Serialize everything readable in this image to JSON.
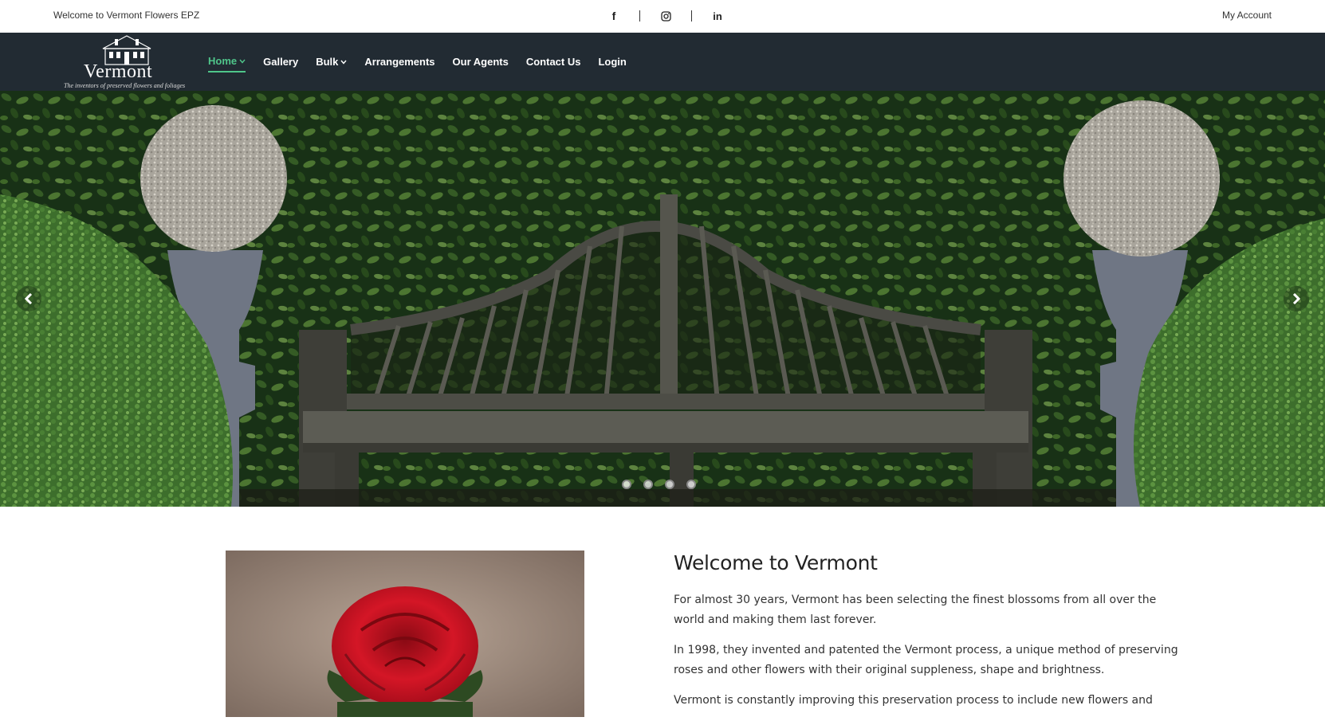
{
  "topbar": {
    "welcome": "Welcome to Vermont Flowers EPZ",
    "social": [
      {
        "icon": "facebook-icon",
        "glyph": "f"
      },
      {
        "icon": "instagram-icon"
      },
      {
        "icon": "linkedin-icon",
        "glyph": "in"
      }
    ],
    "account": "My Account"
  },
  "logo": {
    "word": "Vermont",
    "tagline": "The inventors of preserved flowers and foliages"
  },
  "nav": {
    "items": [
      {
        "label": "Home",
        "active": true,
        "dropdown": true
      },
      {
        "label": "Gallery"
      },
      {
        "label": "Bulk",
        "dropdown": true
      },
      {
        "label": "Arrangements"
      },
      {
        "label": "Our Agents"
      },
      {
        "label": "Contact Us"
      },
      {
        "label": "Login"
      }
    ]
  },
  "hero": {
    "slide_count": 4,
    "active_slide": 1,
    "prev_icon": "chevron-left-icon",
    "next_icon": "chevron-right-icon"
  },
  "welcome": {
    "heading": "Welcome to Vermont",
    "paragraphs": [
      "For almost 30 years, Vermont has been selecting the finest blossoms from all over the world and making them last forever.",
      "In 1998, they invented and patented the Vermont process, a unique method of preserving roses and other flowers with their original suppleness, shape and brightness.",
      "Vermont is constantly improving this preservation process to include new flowers and"
    ]
  },
  "colors": {
    "nav_bg": "#222b33",
    "accent": "#4fc58a"
  }
}
